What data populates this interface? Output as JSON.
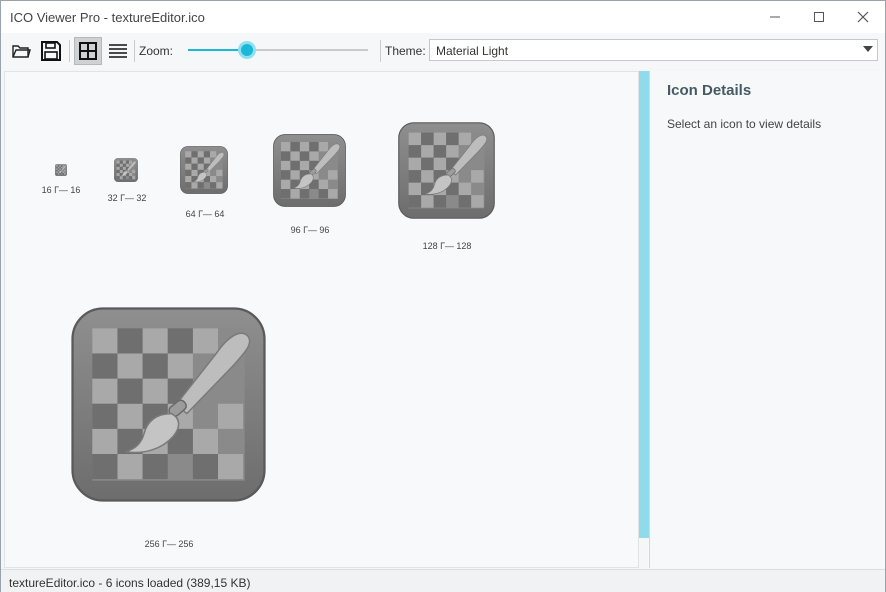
{
  "window": {
    "title": "ICO Viewer Pro - textureEditor.ico"
  },
  "toolbar": {
    "open_icon": "folder-open-icon",
    "save_icon": "save-icon",
    "grid_view_icon": "grid-view-icon",
    "list_view_icon": "list-view-icon",
    "zoom_label": "Zoom:",
    "zoom_level": 0.33,
    "theme_label": "Theme:",
    "theme_value": "Material Light"
  },
  "icons": [
    {
      "caption": "16 Г— 16"
    },
    {
      "caption": "32 Г— 32"
    },
    {
      "caption": "64 Г— 64"
    },
    {
      "caption": "96 Г— 96"
    },
    {
      "caption": "128 Г— 128"
    },
    {
      "caption": "256 Г— 256"
    }
  ],
  "details": {
    "title": "Icon Details",
    "hint": "Select an icon to view details"
  },
  "status": {
    "text": "textureEditor.ico - 6 icons loaded (389,15 KB)"
  },
  "colors": {
    "accent": "#19b8d6",
    "scrollbar": "#8fdbe9",
    "details_title": "#455a64"
  }
}
